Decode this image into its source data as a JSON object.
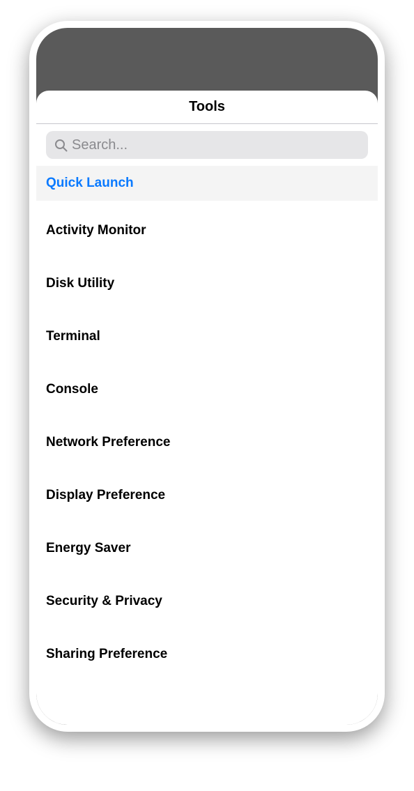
{
  "header": {
    "title": "Tools"
  },
  "search": {
    "placeholder": "Search...",
    "value": ""
  },
  "list": {
    "items": [
      {
        "label": "Quick Launch",
        "selected": true
      },
      {
        "label": "Activity Monitor",
        "selected": false
      },
      {
        "label": "Disk Utility",
        "selected": false
      },
      {
        "label": "Terminal",
        "selected": false
      },
      {
        "label": "Console",
        "selected": false
      },
      {
        "label": "Network Preference",
        "selected": false
      },
      {
        "label": "Display Preference",
        "selected": false
      },
      {
        "label": "Energy Saver",
        "selected": false
      },
      {
        "label": "Security & Privacy",
        "selected": false
      },
      {
        "label": "Sharing Preference",
        "selected": false
      }
    ]
  },
  "colors": {
    "accent": "#0a7aff",
    "selectedBg": "#f4f4f4",
    "divider": "#c7c7cc",
    "searchBg": "#e6e6e8",
    "placeholder": "#8a8a8e"
  }
}
